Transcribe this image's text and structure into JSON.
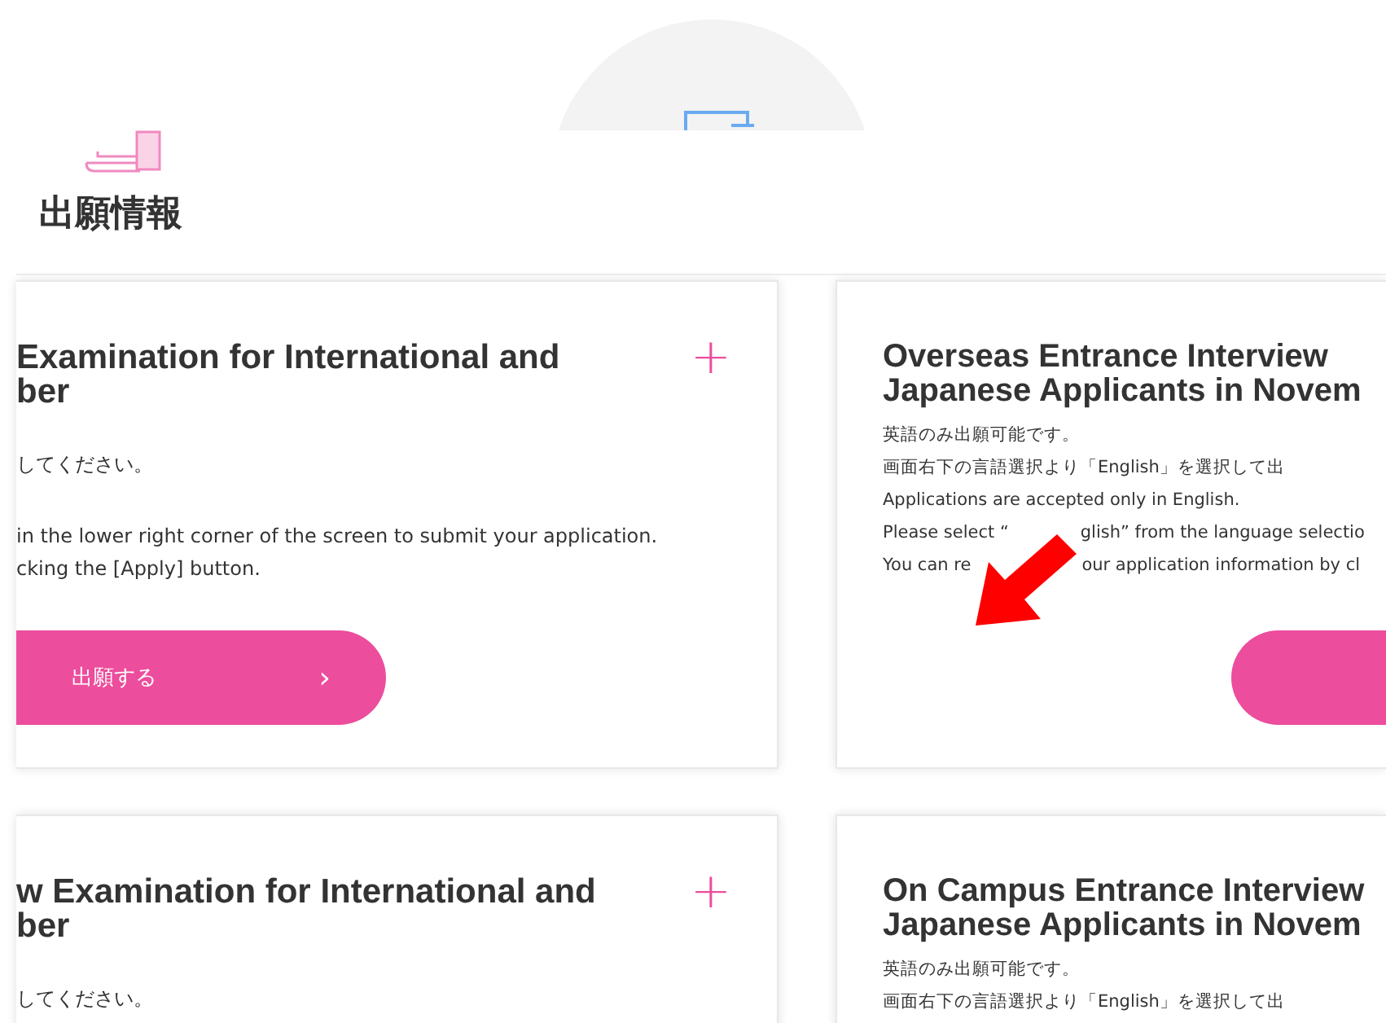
{
  "header": {
    "title": "出願情報"
  },
  "cards": [
    {
      "title_lines": [
        "Examination for International and",
        "ber"
      ],
      "toggle": "+",
      "paragraphs": [
        [
          [
            "してください。"
          ]
        ],
        [
          [
            "in the lower right corner of the screen to submit your application."
          ],
          [
            "cking the [Apply] button."
          ]
        ]
      ],
      "button": {
        "kind": "pill",
        "label": "出願する",
        "chevron": "›"
      }
    },
    {
      "title_lines": [
        "Overseas Entrance Interview",
        "Japanese Applicants in Novem"
      ],
      "paragraphs": [
        [
          [
            "英語のみ出願可能です。"
          ],
          [
            "画面右下の言語選択より「English」を選択して出"
          ],
          [
            "Applications are accepted only in English."
          ],
          [
            "Please select “",
            "glish” from the language selectio"
          ],
          [
            "You can re",
            "our application information by cl"
          ]
        ]
      ],
      "button": {
        "kind": "pill"
      },
      "annotation": {
        "kind": "arrow",
        "color": "#ff0000"
      }
    },
    {
      "title_lines": [
        "w Examination for International and",
        "ber"
      ],
      "toggle": "+",
      "paragraphs": [
        [
          [
            "してください。"
          ]
        ]
      ]
    },
    {
      "title_lines": [
        "On Campus Entrance Interview",
        "Japanese Applicants in Novem"
      ],
      "paragraphs": [
        [
          [
            "英語のみ出願可能です。"
          ],
          [
            "画面右下の言語選択より「English」を選択して出"
          ]
        ]
      ]
    }
  ]
}
